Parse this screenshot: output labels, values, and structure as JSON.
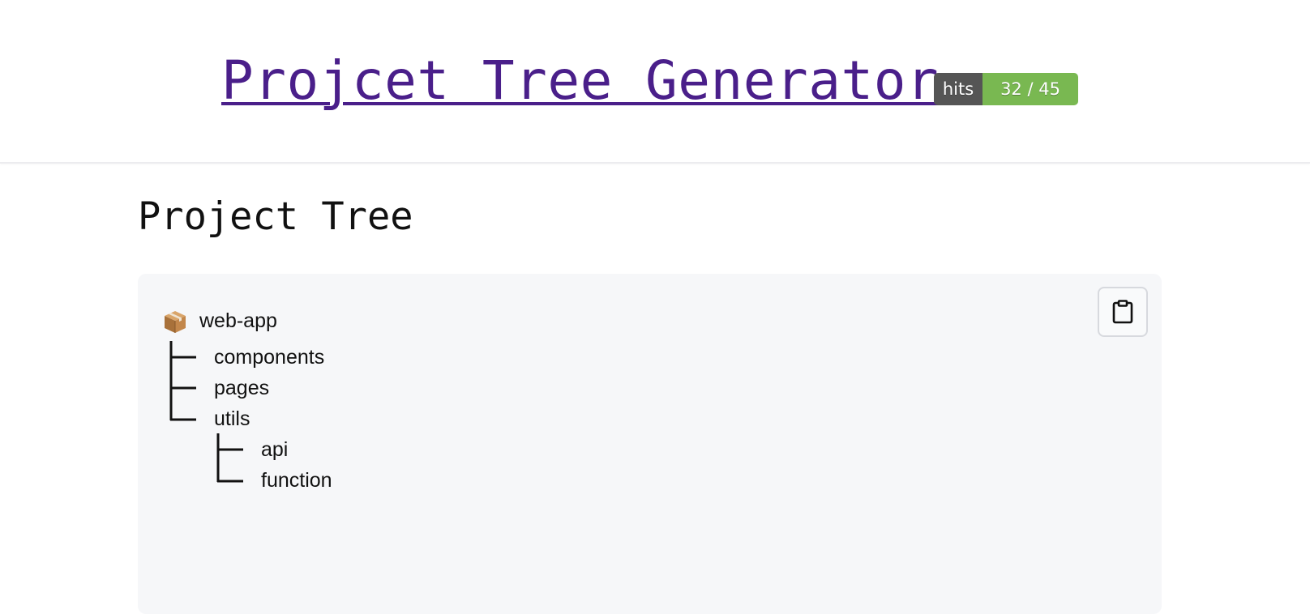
{
  "header": {
    "title": "Projcet Tree Generator",
    "hits_badge": {
      "label": "hits",
      "value": "32 / 45"
    }
  },
  "main": {
    "section_title": "Project Tree",
    "tree": {
      "root": {
        "icon": "package-icon",
        "label": "web-app"
      },
      "children": [
        {
          "label": "components"
        },
        {
          "label": "pages"
        },
        {
          "label": "utils",
          "children": [
            {
              "label": "api"
            },
            {
              "label": "function"
            }
          ]
        }
      ]
    },
    "copy_button": {
      "icon": "clipboard-icon"
    }
  },
  "colors": {
    "title": "#4a1f8a",
    "badge_left": "#555555",
    "badge_right": "#79b851",
    "panel_bg": "#f6f7f9"
  }
}
